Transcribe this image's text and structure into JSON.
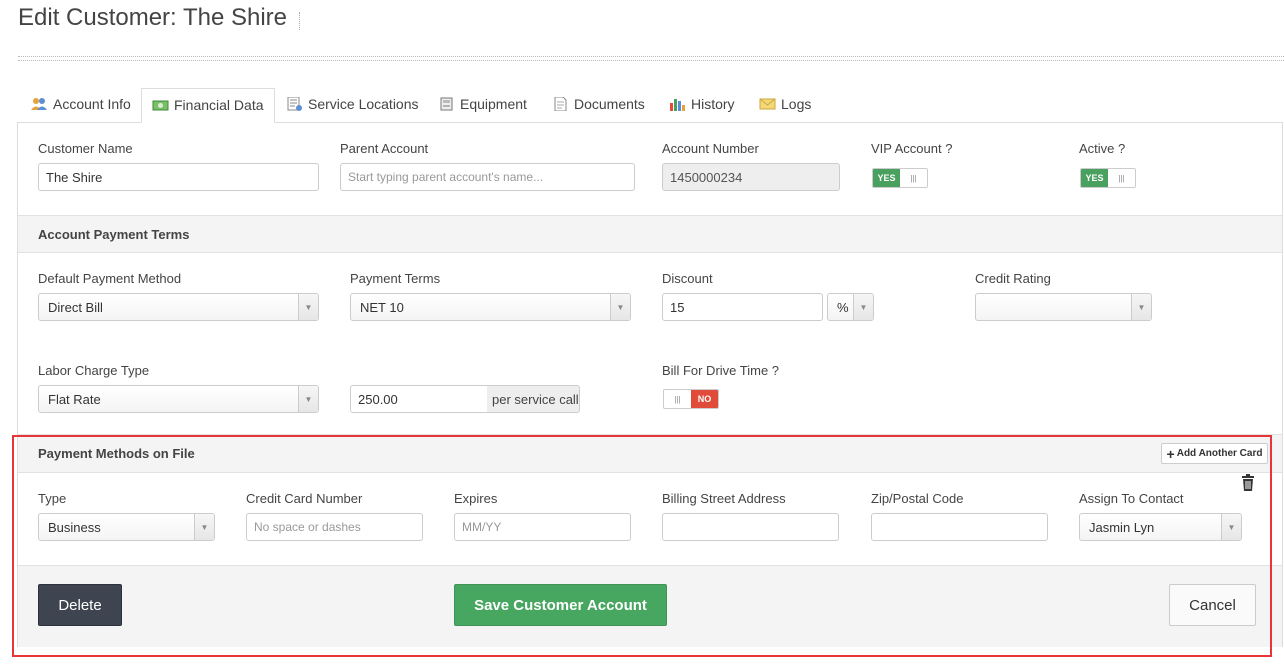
{
  "page": {
    "title": "Edit Customer: The Shire"
  },
  "tabs": [
    {
      "label": "Account Info",
      "icon": "users-icon"
    },
    {
      "label": "Financial Data",
      "icon": "money-icon"
    },
    {
      "label": "Service Locations",
      "icon": "location-list-icon"
    },
    {
      "label": "Equipment",
      "icon": "equipment-icon"
    },
    {
      "label": "Documents",
      "icon": "document-icon"
    },
    {
      "label": "History",
      "icon": "bar-chart-icon"
    },
    {
      "label": "Logs",
      "icon": "envelope-icon"
    }
  ],
  "active_tab": "Financial Data",
  "customer": {
    "name_label": "Customer Name",
    "name_value": "The Shire",
    "parent_label": "Parent Account",
    "parent_placeholder": "Start typing parent account's name...",
    "account_number_label": "Account Number",
    "account_number_value": "1450000234",
    "vip_label": "VIP Account ?",
    "vip_value": "YES",
    "active_label": "Active ?",
    "active_value": "YES"
  },
  "payment_terms": {
    "section_title": "Account Payment Terms",
    "default_method_label": "Default Payment Method",
    "default_method_value": "Direct Bill",
    "terms_label": "Payment Terms",
    "terms_value": "NET 10",
    "discount_label": "Discount",
    "discount_value": "15",
    "discount_unit": "%",
    "credit_rating_label": "Credit Rating",
    "credit_rating_value": "",
    "labor_label": "Labor Charge Type",
    "labor_value": "Flat Rate",
    "labor_amount": "250.00",
    "labor_amount_suffix": "per service call",
    "drive_time_label": "Bill For Drive Time ?",
    "drive_time_value": "NO"
  },
  "payment_methods": {
    "section_title": "Payment Methods on File",
    "add_card_label": "Add Another Card",
    "type_label": "Type",
    "type_value": "Business",
    "card_label": "Credit Card Number",
    "card_placeholder": "No space or dashes",
    "expires_label": "Expires",
    "expires_placeholder": "MM/YY",
    "street_label": "Billing Street Address",
    "street_value": "",
    "zip_label": "Zip/Postal Code",
    "zip_value": "",
    "contact_label": "Assign To Contact",
    "contact_value": "Jasmin Lyn"
  },
  "footer": {
    "delete_label": "Delete",
    "save_label": "Save Customer Account",
    "cancel_label": "Cancel"
  },
  "colors": {
    "save_green": "#47a660",
    "delete_dark": "#3e4551",
    "toggle_yes": "#4aa05f",
    "toggle_no": "#e04b3a",
    "highlight_border": "#e8353a"
  }
}
